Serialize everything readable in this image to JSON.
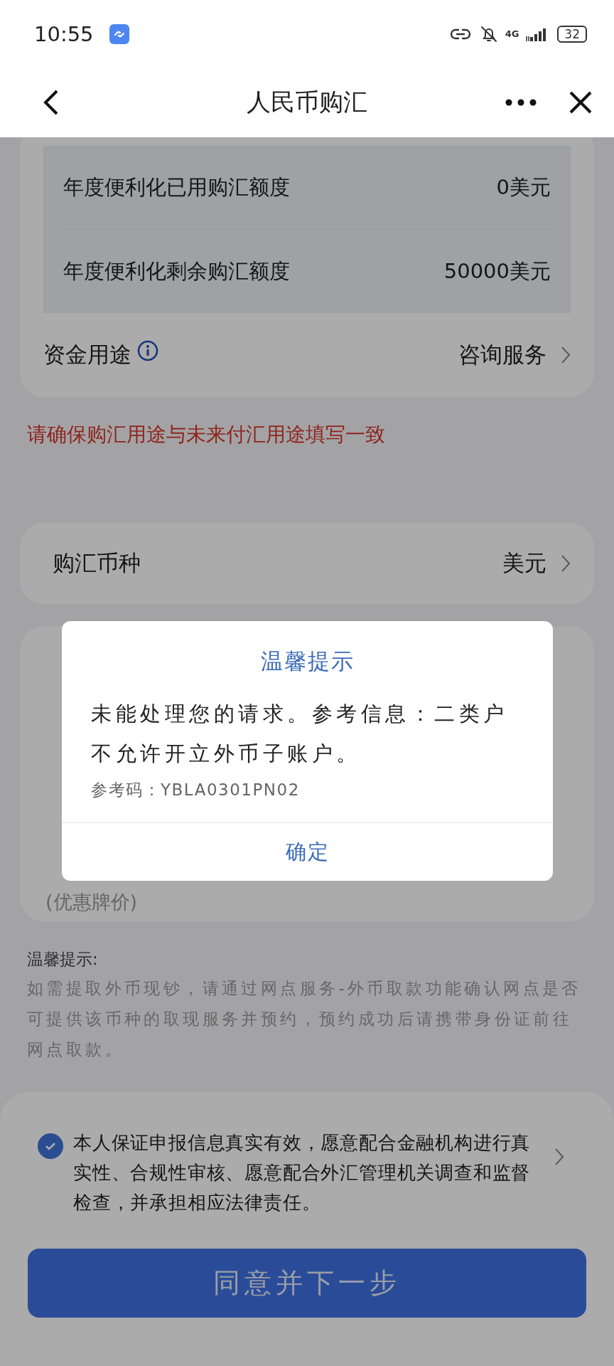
{
  "status_bar": {
    "time": "10:55",
    "network": "4G",
    "battery": "32"
  },
  "header": {
    "title": "人民币购汇"
  },
  "quota_rows": [
    {
      "label": "年度便利化已用购汇额度",
      "value": "0美元"
    },
    {
      "label": "年度便利化剩余购汇额度",
      "value": "50000美元"
    }
  ],
  "purpose": {
    "label": "资金用途",
    "value": "咨询服务"
  },
  "warning": "请确保购汇用途与未来付汇用途填写一致",
  "currency": {
    "label": "购汇币种",
    "value": "美元"
  },
  "rate_note": "(优惠牌价)",
  "tips": {
    "title": "温馨提示:",
    "text": "如需提取外币现钞，请通过网点服务-外币取款功能确认网点是否可提供该币种的取现服务并预约，预约成功后请携带身份证前往网点取款。"
  },
  "agreement": {
    "checked": true,
    "text": "本人保证申报信息真实有效，愿意配合金融机构进行真实性、合规性审核、愿意配合外汇管理机关调查和监督检查，并承担相应法律责任。"
  },
  "submit_button": "同意并下一步",
  "dialog": {
    "title": "温馨提示",
    "message": "未能处理您的请求。参考信息：二类户不允许开立外币子账户。",
    "reference": "参考码：YBLA0301PN02",
    "confirm": "确定"
  }
}
